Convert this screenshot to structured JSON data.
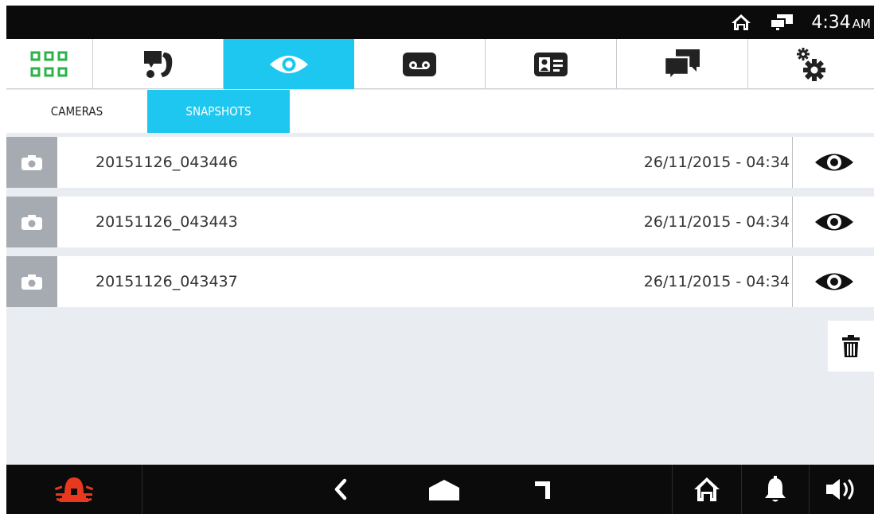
{
  "status_bar": {
    "time": "4:34",
    "ampm": "AM",
    "icons": [
      "home-status-icon",
      "network-status-icon"
    ]
  },
  "main_tabs": [
    {
      "name": "apps",
      "icon": "grid-icon",
      "active": false
    },
    {
      "name": "intercom",
      "icon": "intercom-icon",
      "active": false
    },
    {
      "name": "surveillance",
      "icon": "eye-icon",
      "active": true
    },
    {
      "name": "answering-machine",
      "icon": "voicemail-icon",
      "active": false
    },
    {
      "name": "contacts",
      "icon": "contact-card-icon",
      "active": false
    },
    {
      "name": "messages",
      "icon": "chat-icon",
      "active": false
    },
    {
      "name": "settings",
      "icon": "gears-icon",
      "active": false
    }
  ],
  "sub_tabs": {
    "cameras": "CAMERAS",
    "snapshots": "SNAPSHOTS",
    "active": "snapshots"
  },
  "snapshots": [
    {
      "filename": "20151126_043446",
      "date": "26/11/2015 - 04:34"
    },
    {
      "filename": "20151126_043443",
      "date": "26/11/2015 - 04:34"
    },
    {
      "filename": "20151126_043437",
      "date": "26/11/2015 - 04:34"
    }
  ],
  "nav_bar": {
    "buttons": [
      "alarm-icon",
      "back-icon",
      "home-shape-icon",
      "recent-apps-icon",
      "home-icon",
      "bell-icon",
      "volume-icon"
    ]
  },
  "colors": {
    "accent": "#1ec7ef",
    "alarm": "#e8391f",
    "grid": "#2bb34a",
    "bars": "#0b0b0b"
  }
}
